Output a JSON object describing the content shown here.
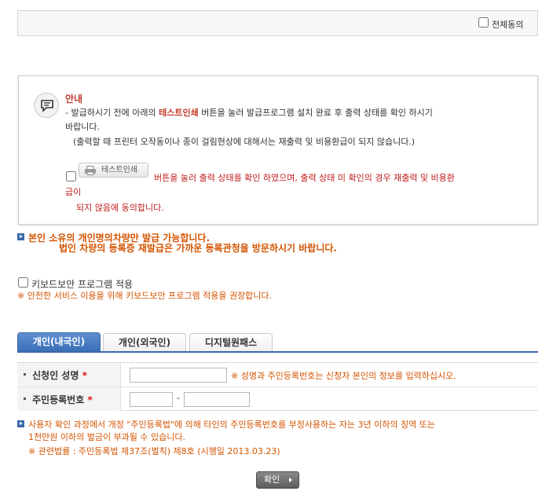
{
  "top": {
    "select_all_label": "전체동의"
  },
  "notice": {
    "title": "안내",
    "line1_prefix": "- 발급하시기 전에 아래의 ",
    "line1_highlight": "테스트인쇄",
    "line1_suffix": " 버튼을 눌러 발급프로그램 설치 완료 후 출력 상태를 확인 하시기",
    "line2": "바랍니다.",
    "line3": "(출력할 때 프린터 오작동이나 종이 걸림현상에 대해서는 재출력 및 비용환급이 되지 않습니다.)",
    "print_button": "테스트인쇄",
    "agree_line1": "버튼을 눌러 출력 상태를 확인 하였으며, 출력 상태 미 확인의 경우 재출력 및 비용환",
    "agree_line2": "급이",
    "agree_line3": "되지 않음에 동의합니다."
  },
  "info": {
    "line1": "본인 소유의 개인명의차량만 발급 가능합니다.",
    "line2": "법인 차량의 등록증 재발급은 가까운 등록관청을 방문하시기 바랍니다."
  },
  "keyboard": {
    "label": "키보드보안 프로그램 적용",
    "note": "※ 안전한 서비스 이용을 위해 키보드보안 프로그램 적용을 권장합니다."
  },
  "tabs": [
    "개인(내국인)",
    "개인(외국인)",
    "디지털원패스"
  ],
  "form": {
    "name_label": "신청인 성명",
    "name_required": "*",
    "name_note": "※ 성명과 주민등록번호는 신청자 본인의 정보를 입력하십시오.",
    "rrn_label": "주민등록번호",
    "rrn_required": "*",
    "rrn_sep": "-"
  },
  "warning": {
    "line1": "사용자 확인 과정에서 개정 \"주민등록법\"에 의해 타인의 주민등록번호를 부정사용하는 자는 3년 이하의 징역 또는",
    "line2": "1천만원 이하의 벌금이 부과될 수 있습니다.",
    "line3": "※ 관련법률 : 주민등록법 제37조(벌칙) 제8호 (시행일 2013.03.23)"
  },
  "confirm_button": "확인"
}
